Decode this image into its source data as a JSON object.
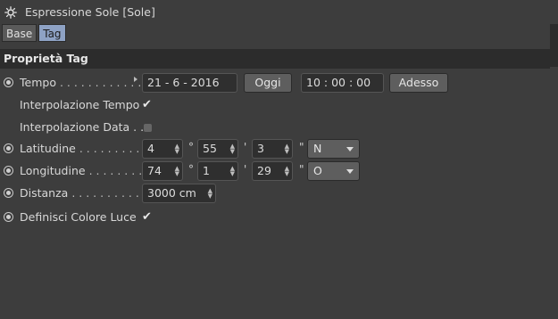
{
  "window": {
    "title": "Espressione Sole [Sole]",
    "icon": "sun-icon"
  },
  "tabs": [
    {
      "label": "Base",
      "active": false
    },
    {
      "label": "Tag",
      "active": true
    }
  ],
  "section": {
    "title": "Proprietà Tag"
  },
  "rows": {
    "tempo": {
      "label": "Tempo",
      "dots": ". . . . . . . . . . . . . .",
      "date": "21 - 6 - 2016",
      "today_button": "Oggi",
      "time": "10 : 00 : 00",
      "now_button": "Adesso"
    },
    "interp_tempo": {
      "label": "Interpolazione Tempo",
      "checked": true,
      "check_glyph": "✔"
    },
    "interp_data": {
      "label": "Interpolazione Data . .",
      "checked": false
    },
    "latitudine": {
      "label": "Latitudine",
      "dots": ". . . . . . . . . . .",
      "deg": "4",
      "deg_unit": "°",
      "min": "55",
      "min_unit": "'",
      "sec": "3",
      "sec_unit": "\"",
      "dir": "N"
    },
    "longitudine": {
      "label": "Longitudine",
      "dots": ". . . . . . . . . .",
      "deg": "74",
      "deg_unit": "°",
      "min": "1",
      "min_unit": "'",
      "sec": "29",
      "sec_unit": "\"",
      "dir": "O"
    },
    "distanza": {
      "label": "Distanza",
      "dots": ". . . . . . . . . . . . .",
      "value": "3000 cm"
    },
    "colore_luce": {
      "label": "Definisci Colore Luce",
      "checked": true,
      "check_glyph": "✔"
    }
  },
  "colors": {
    "background": "#3d3d3d",
    "section_bg": "#2c2c2c",
    "active_tab": "#8ea2c4",
    "field_bg": "#2f2f2f",
    "button_bg": "#5e5e5e"
  }
}
